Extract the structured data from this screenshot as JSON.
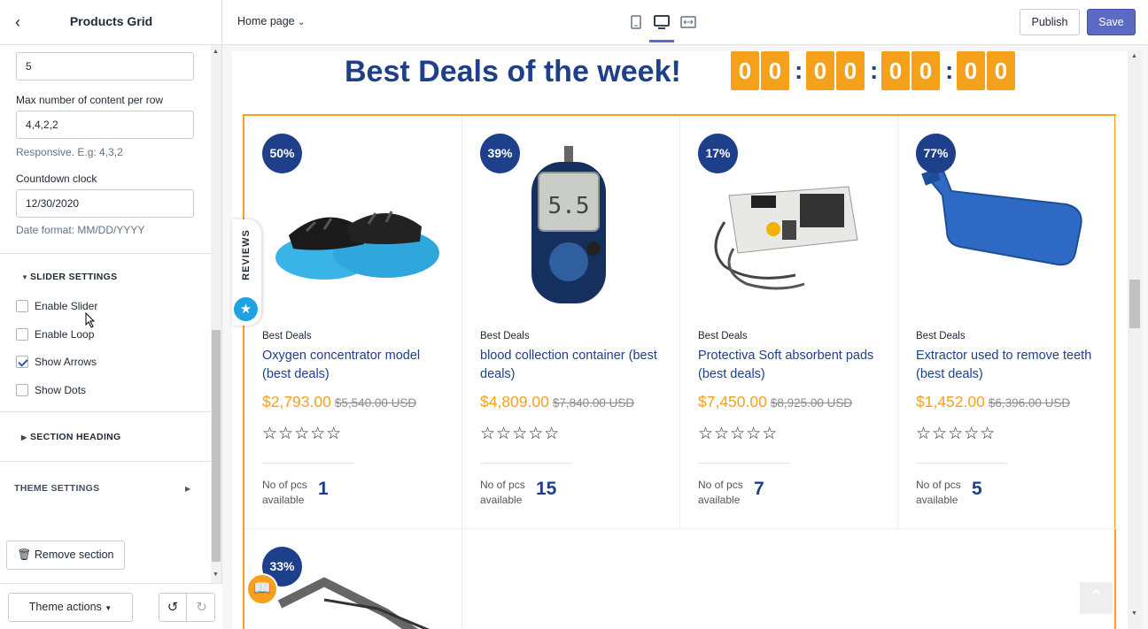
{
  "sidebar": {
    "title": "Products Grid",
    "products_limit_value": "5",
    "max_per_row_label": "Max number of content per row",
    "max_per_row_value": "4,4,2,2",
    "max_per_row_help": "Responsive. E.g: 4,3,2",
    "countdown_label": "Countdown clock",
    "countdown_value": "12/30/2020",
    "countdown_help": "Date format: MM/DD/YYYY",
    "slider_settings": "SLIDER SETTINGS",
    "checkboxes": [
      {
        "label": "Enable Slider",
        "checked": false
      },
      {
        "label": "Enable Loop",
        "checked": false
      },
      {
        "label": "Show Arrows",
        "checked": true
      },
      {
        "label": "Show Dots",
        "checked": false
      }
    ],
    "section_heading": "SECTION HEADING",
    "theme_settings": "THEME SETTINGS",
    "remove_section": "Remove section",
    "theme_actions": "Theme actions"
  },
  "topbar": {
    "page_select": "Home page",
    "publish": "Publish",
    "save": "Save"
  },
  "preview": {
    "heading": "Best Deals of the week!",
    "countdown": [
      "0",
      "0",
      "0",
      "0",
      "0",
      "0",
      "0",
      "0"
    ],
    "reviews_tab": "REVIEWS",
    "available_label": "No of pcs available",
    "products": [
      {
        "badge": "50%",
        "vendor": "Best Deals",
        "title": "Oxygen concentrator model (best deals)",
        "price": "$2,793.00",
        "old_price": "$5,540.00 USD",
        "stars": "☆☆☆☆☆",
        "qty": "1",
        "image": "shoe-covers-image"
      },
      {
        "badge": "39%",
        "vendor": "Best Deals",
        "title": "blood collection container (best deals)",
        "price": "$4,809.00",
        "old_price": "$7,840.00 USD",
        "stars": "☆☆☆☆☆",
        "qty": "15",
        "image": "glucose-meter-image",
        "meter_reading": "5.5"
      },
      {
        "badge": "17%",
        "vendor": "Best Deals",
        "title": "Protectiva Soft absorbent pads (best deals)",
        "price": "$7,450.00",
        "old_price": "$8,925.00 USD",
        "stars": "☆☆☆☆☆",
        "qty": "7",
        "image": "defibrillator-image"
      },
      {
        "badge": "77%",
        "vendor": "Best Deals",
        "title": "Extractor used to remove teeth (best deals)",
        "price": "$1,452.00",
        "old_price": "$6,396.00 USD",
        "stars": "☆☆☆☆☆",
        "qty": "5",
        "image": "hot-water-bottle-image"
      }
    ],
    "partial_product": {
      "badge": "33%",
      "image": "stretcher-image"
    }
  },
  "colors": {
    "accent": "#f5a11c",
    "brand": "#1e3f8a",
    "save": "#5c6ac4",
    "reviews": "#1fa3e0"
  }
}
